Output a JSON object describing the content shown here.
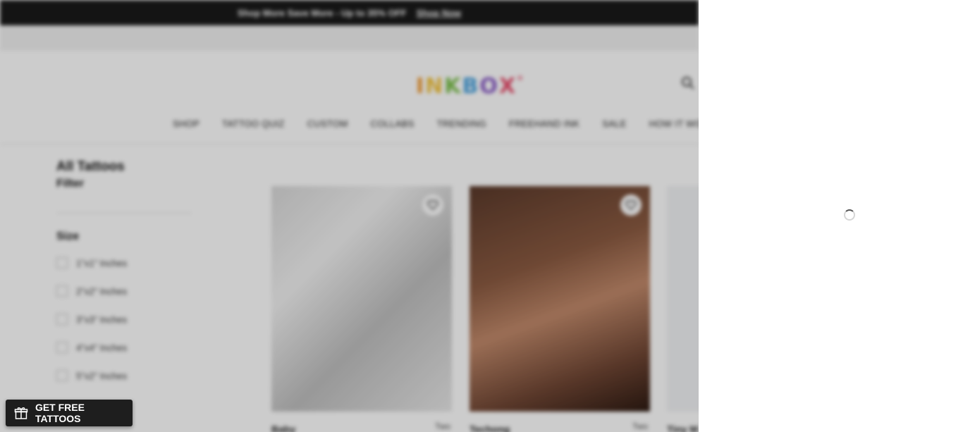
{
  "promo": {
    "text": "Shop More Save More - Up to 35% OFF",
    "link": "Shop Now"
  },
  "brand": {
    "logo_letters": [
      "I",
      "N",
      "K",
      "B",
      "O",
      "X"
    ],
    "mark": "°"
  },
  "nav": [
    "SHOP",
    "TATTOO QUIZ",
    "CUSTOM",
    "COLLABS",
    "TRENDING",
    "FREEHAND INK",
    "SALE",
    "HOW IT WORK"
  ],
  "sidebar": {
    "title": "All Tattoos",
    "filter": "Filter",
    "size_heading": "Size",
    "sizes": [
      "1\"x1\" Inches",
      "2\"x2\" Inches",
      "3\"x3\" Inches",
      "4\"x4\" Inches",
      "5\"x2\" Inches"
    ]
  },
  "products": [
    {
      "title": "Baby",
      "meta": "Two"
    },
    {
      "title": "Techong",
      "meta": "Two"
    },
    {
      "title": "Tiny M"
    }
  ],
  "gift_button": {
    "label": "GET FREE TATTOOS"
  },
  "colors": {
    "promo_bg": "#1a1a1a",
    "overlay": "rgba(0,0,0,0.2)",
    "logo": [
      "#f29a2e",
      "#f4c542",
      "#7cc04b",
      "#4aa3df",
      "#8a5cc7",
      "#e84b6a"
    ]
  },
  "icons": [
    "search-icon",
    "heart-icon",
    "gift-icon",
    "loading-spinner-icon"
  ]
}
